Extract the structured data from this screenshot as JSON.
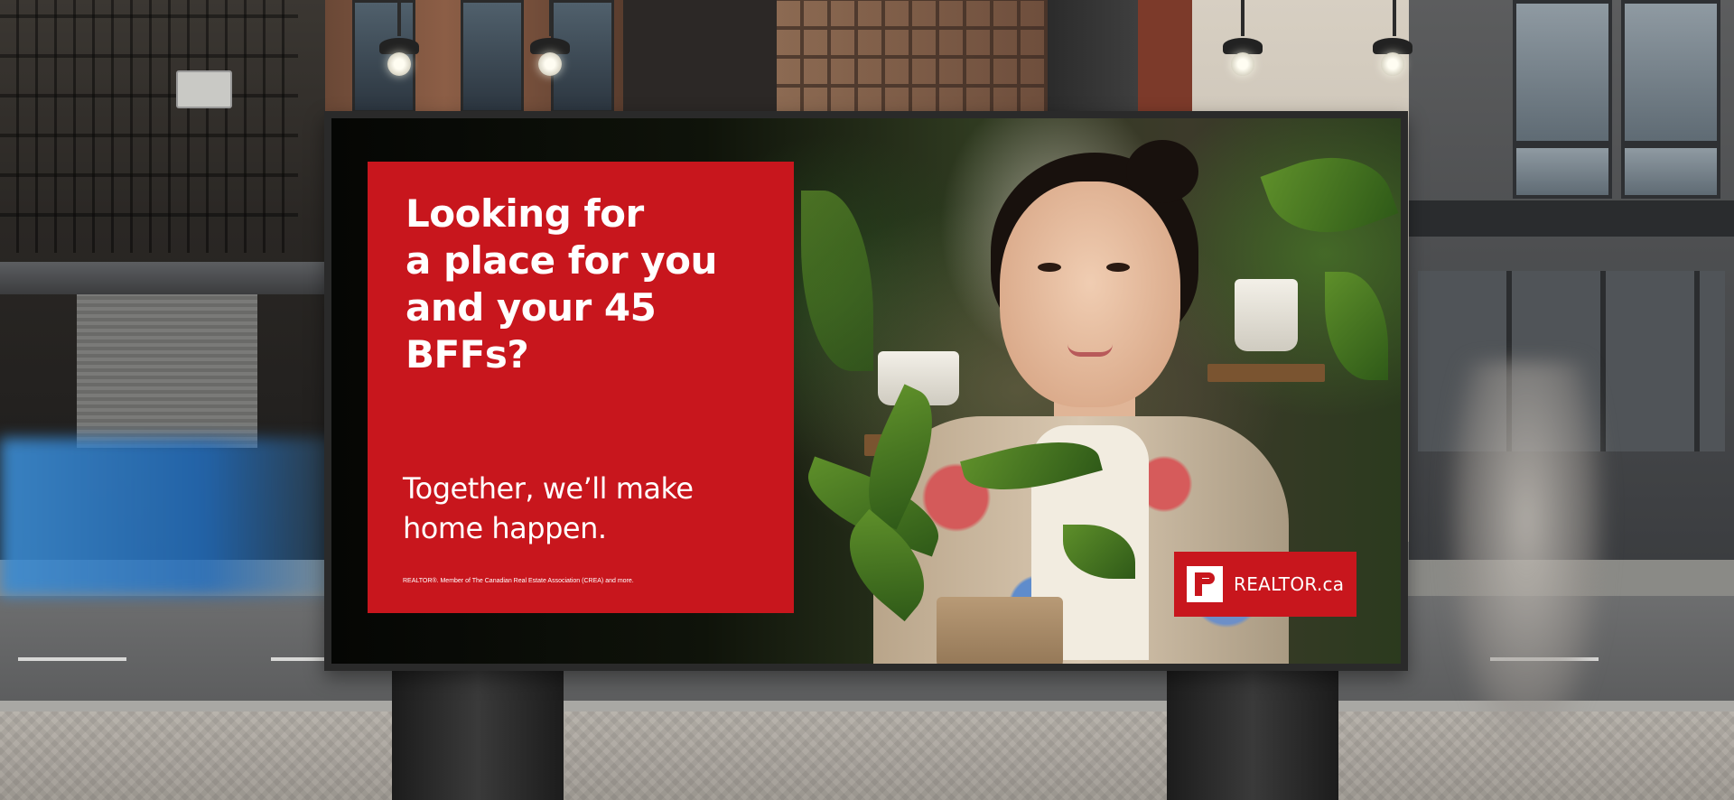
{
  "billboard": {
    "headline": "Looking for\na place for you\nand your 45 BFFs?",
    "subheadline": "Together, we’ll make\nhome happen.",
    "fine_print": "REALTOR®. Member of The Canadian Real Estate Association (CREA) and more.",
    "logo_text": "REALTOR.ca",
    "panel_color": "#c8161d"
  }
}
